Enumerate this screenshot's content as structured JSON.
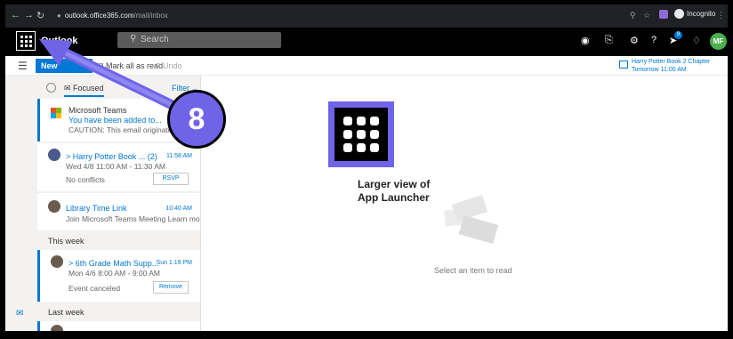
{
  "browser": {
    "url_host": "outlook.office365.com",
    "url_path": "/mail/inbox",
    "incognito_label": "Incognito"
  },
  "header": {
    "app_name": "Outlook",
    "search_placeholder": "Search",
    "avatar_initials": "MF",
    "notification_count": "9"
  },
  "commands": {
    "new_label": "New",
    "mark_all_read": "Mark all as read",
    "undo": "Undo"
  },
  "reminder": {
    "title": "Harry Potter Book 2 Chapter",
    "when": "Tomorrow 11:00 AM"
  },
  "tabs": {
    "focused": "Focused",
    "filter": "Filter"
  },
  "messages": [
    {
      "sender": "Microsoft Teams",
      "subject": "You have been added to...",
      "preview": "CAUTION: This email originated fro",
      "time": ""
    },
    {
      "sender": "",
      "subject": "> Harry Potter Book ... (2)",
      "preview": "Wed 4/8 11:00 AM - 11:30 AM",
      "status": "No conflicts",
      "action": "RSVP",
      "time": "11:58 AM"
    },
    {
      "sender": "",
      "subject": "Library Time Link",
      "preview": "Join Microsoft Teams Meeting Learn mor...",
      "time": "10:40 AM"
    },
    {
      "sender": "",
      "subject": "> 6th Grade Math Supp...",
      "preview": "Mon 4/6 8:00 AM - 9:00 AM",
      "status": "Event canceled",
      "action": "Remove",
      "time": "Sun 1:19 PM"
    }
  ],
  "sections": {
    "this_week": "This week",
    "last_week": "Last week"
  },
  "reading_pane": {
    "empty_text": "Select an item to read"
  },
  "annotation": {
    "step_number": "8",
    "caption_line1": "Larger view of",
    "caption_line2": "App Launcher",
    "accent_color": "#6f64e8"
  }
}
